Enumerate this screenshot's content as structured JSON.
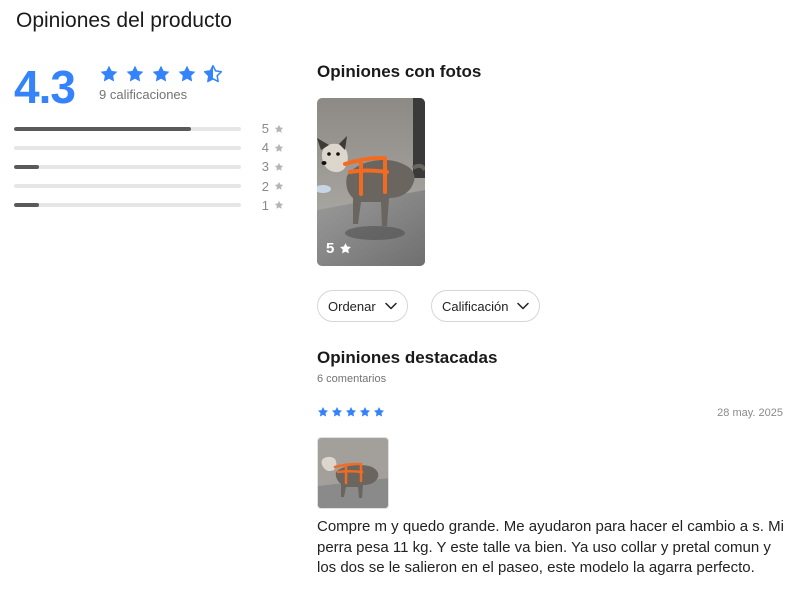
{
  "page": {
    "title": "Opiniones del producto"
  },
  "summary": {
    "score": "4.3",
    "score_value": 4.3,
    "ratings_count_label": "9 calificaciones",
    "star_color": "#3483fa",
    "histogram": [
      {
        "stars": "5",
        "fraction": 0.78
      },
      {
        "stars": "4",
        "fraction": 0.0
      },
      {
        "stars": "3",
        "fraction": 0.11
      },
      {
        "stars": "2",
        "fraction": 0.0
      },
      {
        "stars": "1",
        "fraction": 0.11
      }
    ]
  },
  "photos_section": {
    "title": "Opiniones con fotos",
    "items": [
      {
        "rating": "5",
        "icon": "star-icon"
      }
    ]
  },
  "filters": {
    "sort_label": "Ordenar",
    "rating_label": "Calificación",
    "icon": "chevron-down-icon"
  },
  "featured": {
    "title": "Opiniones destacadas",
    "count_label": "6 comentarios",
    "reviews": [
      {
        "rating": 5,
        "date": "28 may. 2025",
        "text": "Compre m y quedo grande. Me ayudaron para hacer el cambio a s. Mi perra pesa 11 kg. Y este talle va bien. Ya uso collar y pretal comun y los dos se le salieron en el paseo, este modelo la agarra perfecto."
      }
    ]
  }
}
